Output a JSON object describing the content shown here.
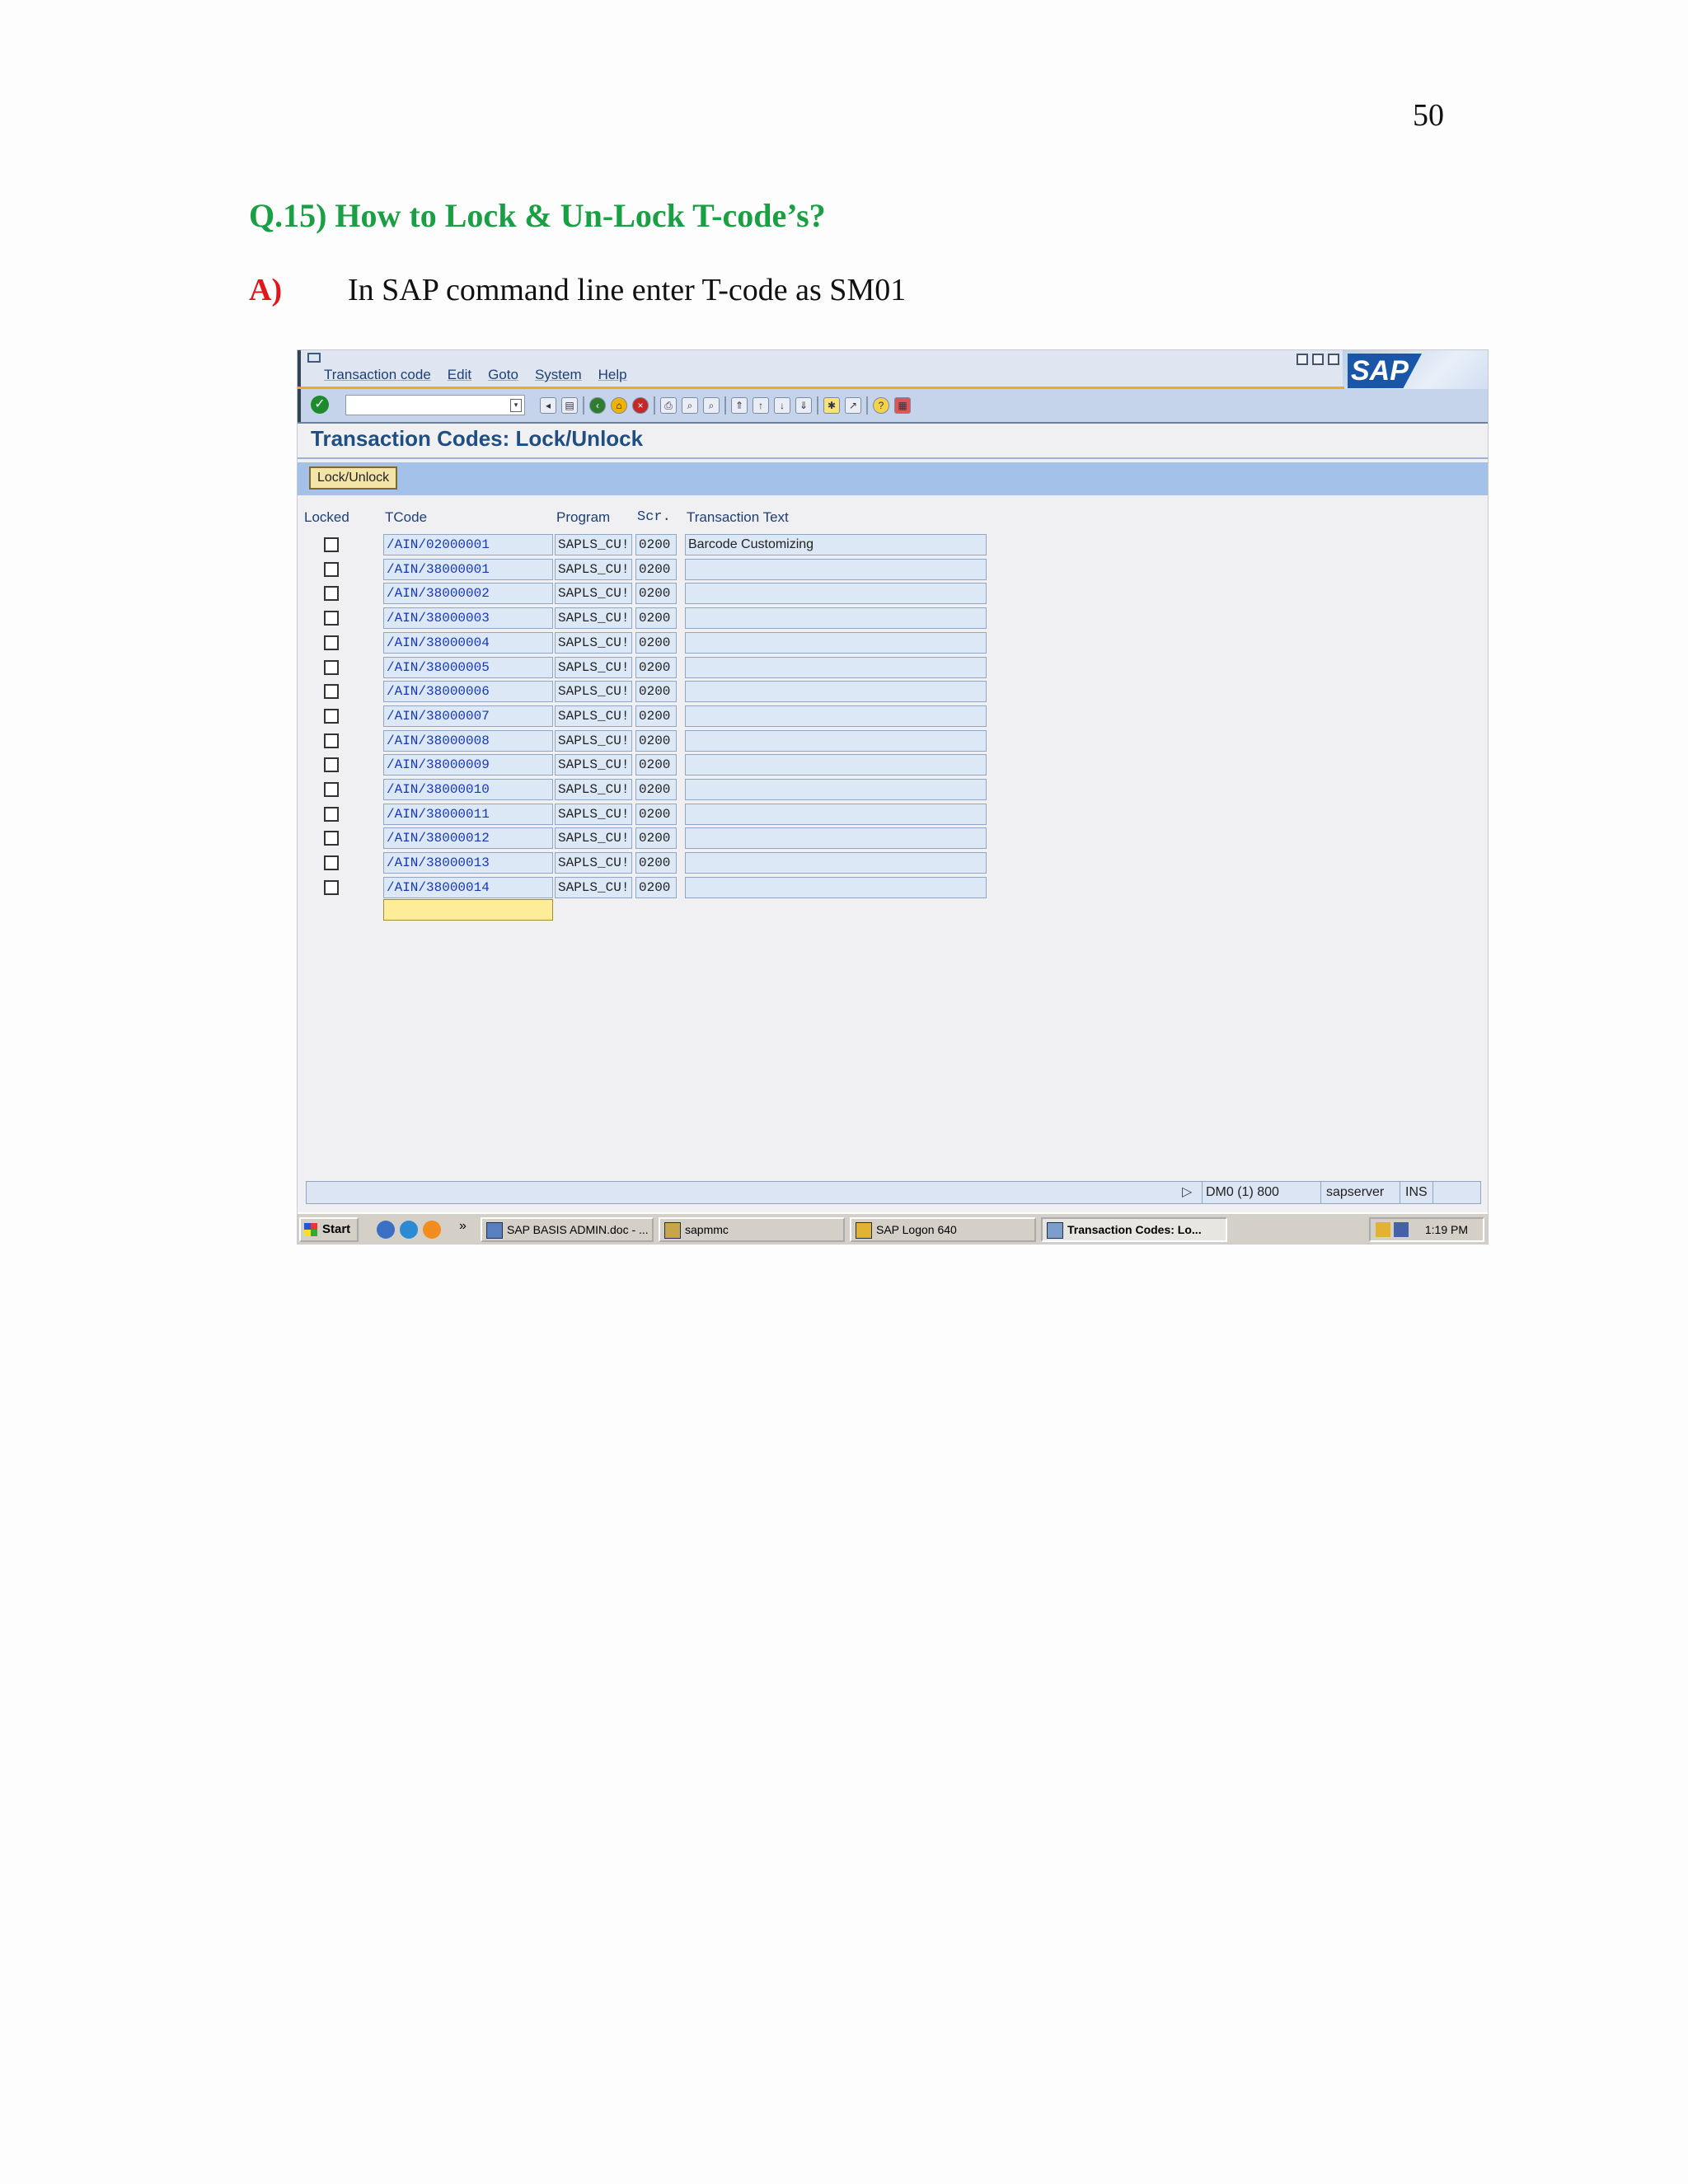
{
  "page_number": "50",
  "question": "Q.15) How to Lock & Un-Lock T-code’s?",
  "answer": {
    "label": "A)",
    "text": "In SAP command line enter T-code as SM01"
  },
  "screenshot": {
    "menu": [
      "Transaction code",
      "Edit",
      "Goto",
      "System",
      "Help"
    ],
    "logo_text": "SAP",
    "title": "Transaction Codes: Lock/Unlock",
    "lock_button_label": "Lock/Unlock",
    "columns": {
      "locked": "Locked",
      "tcode": "TCode",
      "program": "Program",
      "screen": "Scr.",
      "text": "Transaction Text"
    },
    "rows": [
      {
        "tcode": "/AIN/02000001",
        "program": "SAPLS_CU!",
        "screen": "0200",
        "text": "Barcode Customizing",
        "locked": false
      },
      {
        "tcode": "/AIN/38000001",
        "program": "SAPLS_CU!",
        "screen": "0200",
        "text": "",
        "locked": false
      },
      {
        "tcode": "/AIN/38000002",
        "program": "SAPLS_CU!",
        "screen": "0200",
        "text": "",
        "locked": false
      },
      {
        "tcode": "/AIN/38000003",
        "program": "SAPLS_CU!",
        "screen": "0200",
        "text": "",
        "locked": false
      },
      {
        "tcode": "/AIN/38000004",
        "program": "SAPLS_CU!",
        "screen": "0200",
        "text": "",
        "locked": false
      },
      {
        "tcode": "/AIN/38000005",
        "program": "SAPLS_CU!",
        "screen": "0200",
        "text": "",
        "locked": false
      },
      {
        "tcode": "/AIN/38000006",
        "program": "SAPLS_CU!",
        "screen": "0200",
        "text": "",
        "locked": false
      },
      {
        "tcode": "/AIN/38000007",
        "program": "SAPLS_CU!",
        "screen": "0200",
        "text": "",
        "locked": false
      },
      {
        "tcode": "/AIN/38000008",
        "program": "SAPLS_CU!",
        "screen": "0200",
        "text": "",
        "locked": false
      },
      {
        "tcode": "/AIN/38000009",
        "program": "SAPLS_CU!",
        "screen": "0200",
        "text": "",
        "locked": false
      },
      {
        "tcode": "/AIN/38000010",
        "program": "SAPLS_CU!",
        "screen": "0200",
        "text": "",
        "locked": false
      },
      {
        "tcode": "/AIN/38000011",
        "program": "SAPLS_CU!",
        "screen": "0200",
        "text": "",
        "locked": false
      },
      {
        "tcode": "/AIN/38000012",
        "program": "SAPLS_CU!",
        "screen": "0200",
        "text": "",
        "locked": false
      },
      {
        "tcode": "/AIN/38000013",
        "program": "SAPLS_CU!",
        "screen": "0200",
        "text": "",
        "locked": false
      },
      {
        "tcode": "/AIN/38000014",
        "program": "SAPLS_CU!",
        "screen": "0200",
        "text": "",
        "locked": false
      }
    ],
    "status": {
      "system": "DM0 (1) 800",
      "server": "sapserver",
      "mode": "INS"
    },
    "taskbar": {
      "start": "Start",
      "more": "»",
      "tasks": [
        "SAP BASIS ADMIN.doc - ...",
        "sapmmc",
        "SAP Logon 640",
        "Transaction Codes: Lo..."
      ],
      "clock": "1:19 PM"
    },
    "colors": {
      "question": "#1aa044",
      "answer_label": "#e0161b",
      "title": "#1f4e82",
      "tcode_text": "#1637b8"
    }
  }
}
